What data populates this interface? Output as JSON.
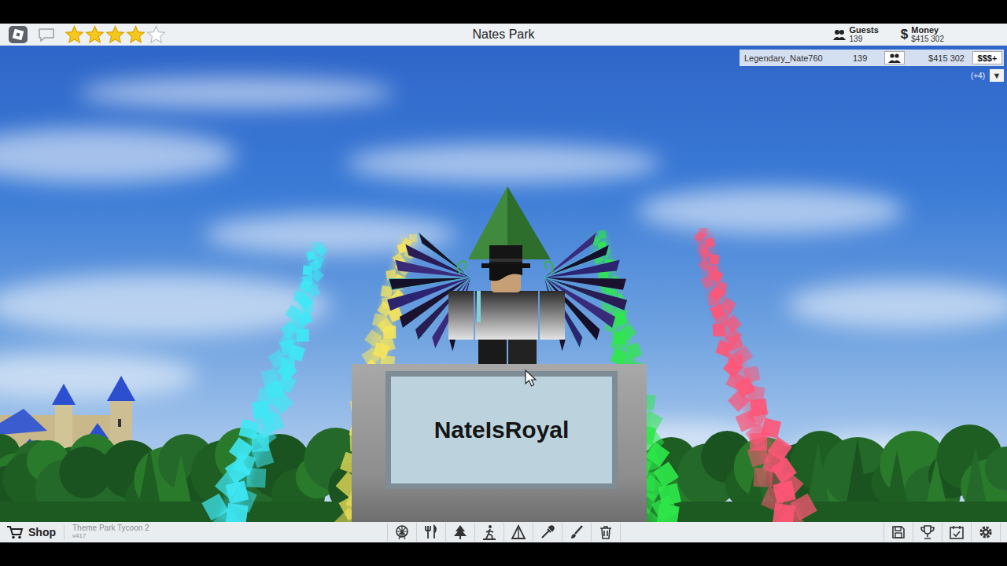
{
  "top_bar": {
    "title": "Nates Park",
    "stars": 4,
    "guests": {
      "label": "Guests",
      "value": "139"
    },
    "money": {
      "symbol": "$",
      "label": "Money",
      "value": "$415 302"
    }
  },
  "leaderboard": {
    "player": "Legendary_Nate760",
    "guests": "139",
    "money": "$415 302",
    "buy": "$$$+",
    "more": "(+4)",
    "toggle": "▼"
  },
  "scene": {
    "sign": "NateIsRoyal",
    "streaks": [
      {
        "color": "#3ee8f5"
      },
      {
        "color": "#f7e55a"
      },
      {
        "color": "#2ee84a"
      },
      {
        "color": "#ff5577"
      }
    ]
  },
  "bottom_bar": {
    "shop": "Shop",
    "game": "Theme Park Tycoon 2",
    "version": "v417"
  }
}
